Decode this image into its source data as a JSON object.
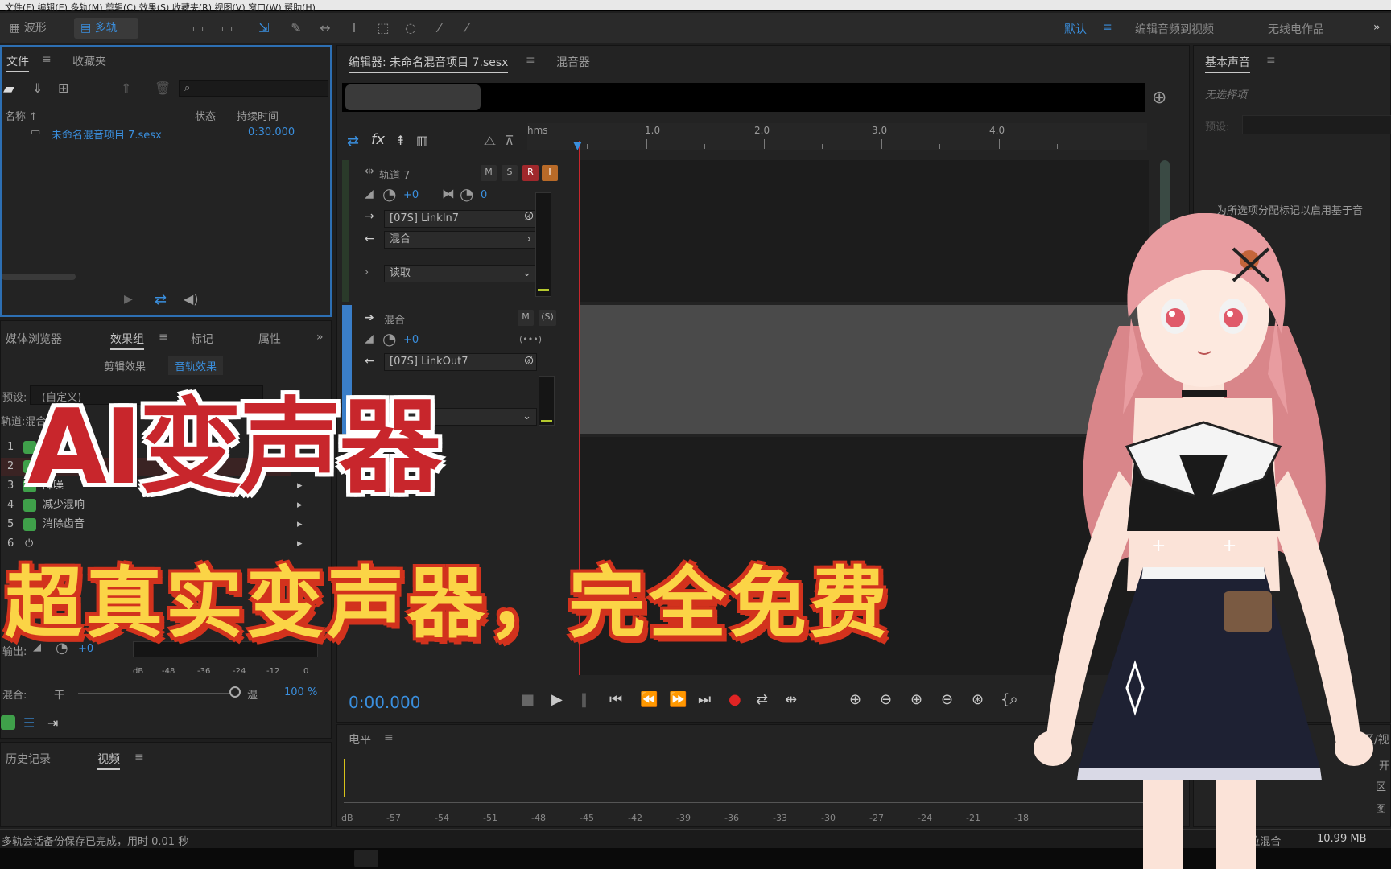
{
  "menu": {
    "text": "文件(F)  编辑(E)  多轨(M)  剪辑(C)  效果(S)  收藏夹(R)  视图(V)  窗口(W)  帮助(H)"
  },
  "toolbar": {
    "waveform_label": "波形",
    "multitrack_label": "多轨",
    "workspace_default": "默认",
    "edit_audio_to_video": "编辑音频到视频",
    "wireless_work": "无线电作品"
  },
  "files_panel": {
    "tab_files": "文件",
    "tab_favorites": "收藏夹",
    "col_name": "名称 ↑",
    "col_status": "状态",
    "col_duration": "持续时间",
    "file_name": "未命名混音项目 7.sesx",
    "file_duration": "0:30.000"
  },
  "effects_panel": {
    "tab_media": "媒体浏览器",
    "tab_effects": "效果组",
    "tab_markers": "标记",
    "tab_properties": "属性",
    "sub_clip": "剪辑效果",
    "sub_track": "音轨效果",
    "preset_label": "预设:",
    "preset_value": "(自定义)",
    "track_label": "轨道:混合",
    "effects": [
      {
        "n": "1",
        "name": ""
      },
      {
        "n": "2",
        "name": "自适应降"
      },
      {
        "n": "3",
        "name": "降噪"
      },
      {
        "n": "4",
        "name": "减少混响"
      },
      {
        "n": "5",
        "name": "消除齿音"
      },
      {
        "n": "6",
        "name": ""
      }
    ],
    "output_label": "输出:",
    "output_value": "+0",
    "meter_scale": [
      "dB",
      "-48",
      "-36",
      "-24",
      "-12",
      "0"
    ],
    "mix_label": "混合:",
    "dry_label": "干",
    "wet_label": "湿",
    "mix_value": "100 %"
  },
  "history_panel": {
    "tab_history": "历史记录",
    "tab_video": "视频"
  },
  "editor": {
    "tab_editor": "编辑器: 未命名混音项目 7.sesx",
    "tab_mixer": "混音器",
    "ruler": [
      "hms",
      "1.0",
      "2.0",
      "3.0",
      "4.0"
    ],
    "track7": {
      "name": "轨道 7",
      "m": "M",
      "s": "S",
      "r": "R",
      "i": "I",
      "vol": "+0",
      "pan": "0",
      "input": "[07S] LinkIn7",
      "output": "混合",
      "read": "读取"
    },
    "mix": {
      "name": "混合",
      "m": "M",
      "s": "(S)",
      "vol": "+0",
      "output": "[07S] LinkOut7"
    },
    "time": "0:00.000"
  },
  "levels_panel": {
    "title": "电平",
    "scale": [
      "dB",
      "-57",
      "-54",
      "-51",
      "-48",
      "-45",
      "-42",
      "-39",
      "-36",
      "-33",
      "-30",
      "-27",
      "-24",
      "-21",
      "-18"
    ]
  },
  "essential_sound": {
    "title": "基本声音",
    "no_selection": "无选择项",
    "preset_label": "预设:",
    "hint": "为所选项分配标记以启用基于音"
  },
  "selection_panel": {
    "title": "选区/视",
    "start": "开",
    "l1": "区",
    "l2": "图"
  },
  "status": {
    "left": "多轨会话备份保存已完成，用时 0.01 秒",
    "mix": "2 位混合",
    "size": "10.99 MB"
  },
  "overlay": {
    "title": "AI变声器",
    "subtitle": "超真实变声器，完全免费"
  }
}
